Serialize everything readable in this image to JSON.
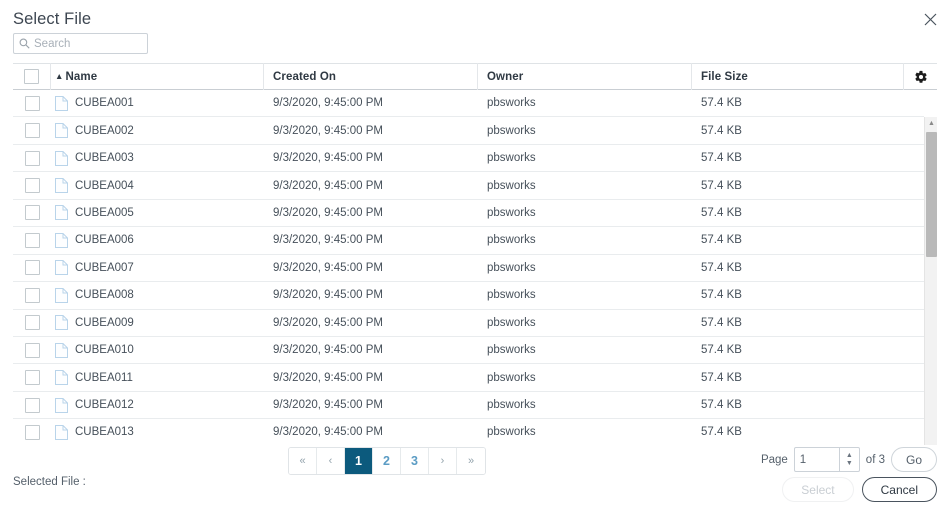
{
  "dialog": {
    "title": "Select File",
    "close_icon": "close-icon"
  },
  "search": {
    "placeholder": "Search",
    "value": "",
    "icon": "search-icon"
  },
  "table": {
    "sort_caret": "▲",
    "gear_icon": "gear-icon",
    "columns": [
      {
        "key": "name",
        "label": "Name",
        "sorted": true
      },
      {
        "key": "created",
        "label": "Created On",
        "sorted": false
      },
      {
        "key": "owner",
        "label": "Owner",
        "sorted": false
      },
      {
        "key": "size",
        "label": "File Size",
        "sorted": false
      }
    ],
    "rows": [
      {
        "name": "CUBEA001",
        "created": "9/3/2020, 9:45:00 PM",
        "owner": "pbsworks",
        "size": "57.4 KB"
      },
      {
        "name": "CUBEA002",
        "created": "9/3/2020, 9:45:00 PM",
        "owner": "pbsworks",
        "size": "57.4 KB"
      },
      {
        "name": "CUBEA003",
        "created": "9/3/2020, 9:45:00 PM",
        "owner": "pbsworks",
        "size": "57.4 KB"
      },
      {
        "name": "CUBEA004",
        "created": "9/3/2020, 9:45:00 PM",
        "owner": "pbsworks",
        "size": "57.4 KB"
      },
      {
        "name": "CUBEA005",
        "created": "9/3/2020, 9:45:00 PM",
        "owner": "pbsworks",
        "size": "57.4 KB"
      },
      {
        "name": "CUBEA006",
        "created": "9/3/2020, 9:45:00 PM",
        "owner": "pbsworks",
        "size": "57.4 KB"
      },
      {
        "name": "CUBEA007",
        "created": "9/3/2020, 9:45:00 PM",
        "owner": "pbsworks",
        "size": "57.4 KB"
      },
      {
        "name": "CUBEA008",
        "created": "9/3/2020, 9:45:00 PM",
        "owner": "pbsworks",
        "size": "57.4 KB"
      },
      {
        "name": "CUBEA009",
        "created": "9/3/2020, 9:45:00 PM",
        "owner": "pbsworks",
        "size": "57.4 KB"
      },
      {
        "name": "CUBEA010",
        "created": "9/3/2020, 9:45:00 PM",
        "owner": "pbsworks",
        "size": "57.4 KB"
      },
      {
        "name": "CUBEA011",
        "created": "9/3/2020, 9:45:00 PM",
        "owner": "pbsworks",
        "size": "57.4 KB"
      },
      {
        "name": "CUBEA012",
        "created": "9/3/2020, 9:45:00 PM",
        "owner": "pbsworks",
        "size": "57.4 KB"
      },
      {
        "name": "CUBEA013",
        "created": "9/3/2020, 9:45:00 PM",
        "owner": "pbsworks",
        "size": "57.4 KB"
      }
    ]
  },
  "pagination": {
    "first_label": "«",
    "prev_label": "‹",
    "next_label": "›",
    "last_label": "»",
    "pages": [
      "1",
      "2",
      "3"
    ],
    "active_page": "1"
  },
  "page_control": {
    "page_label": "Page",
    "page_value": "1",
    "of_label": "of 3",
    "go_label": "Go",
    "spin_up": "▲",
    "spin_down": "▼"
  },
  "footer": {
    "selected_file_label": "Selected File :",
    "select_label": "Select",
    "cancel_label": "Cancel"
  },
  "colors": {
    "accent": "#0c5a7d",
    "page_link": "#5b9cc4",
    "text": "#46505a",
    "border": "#ccd2d8"
  }
}
